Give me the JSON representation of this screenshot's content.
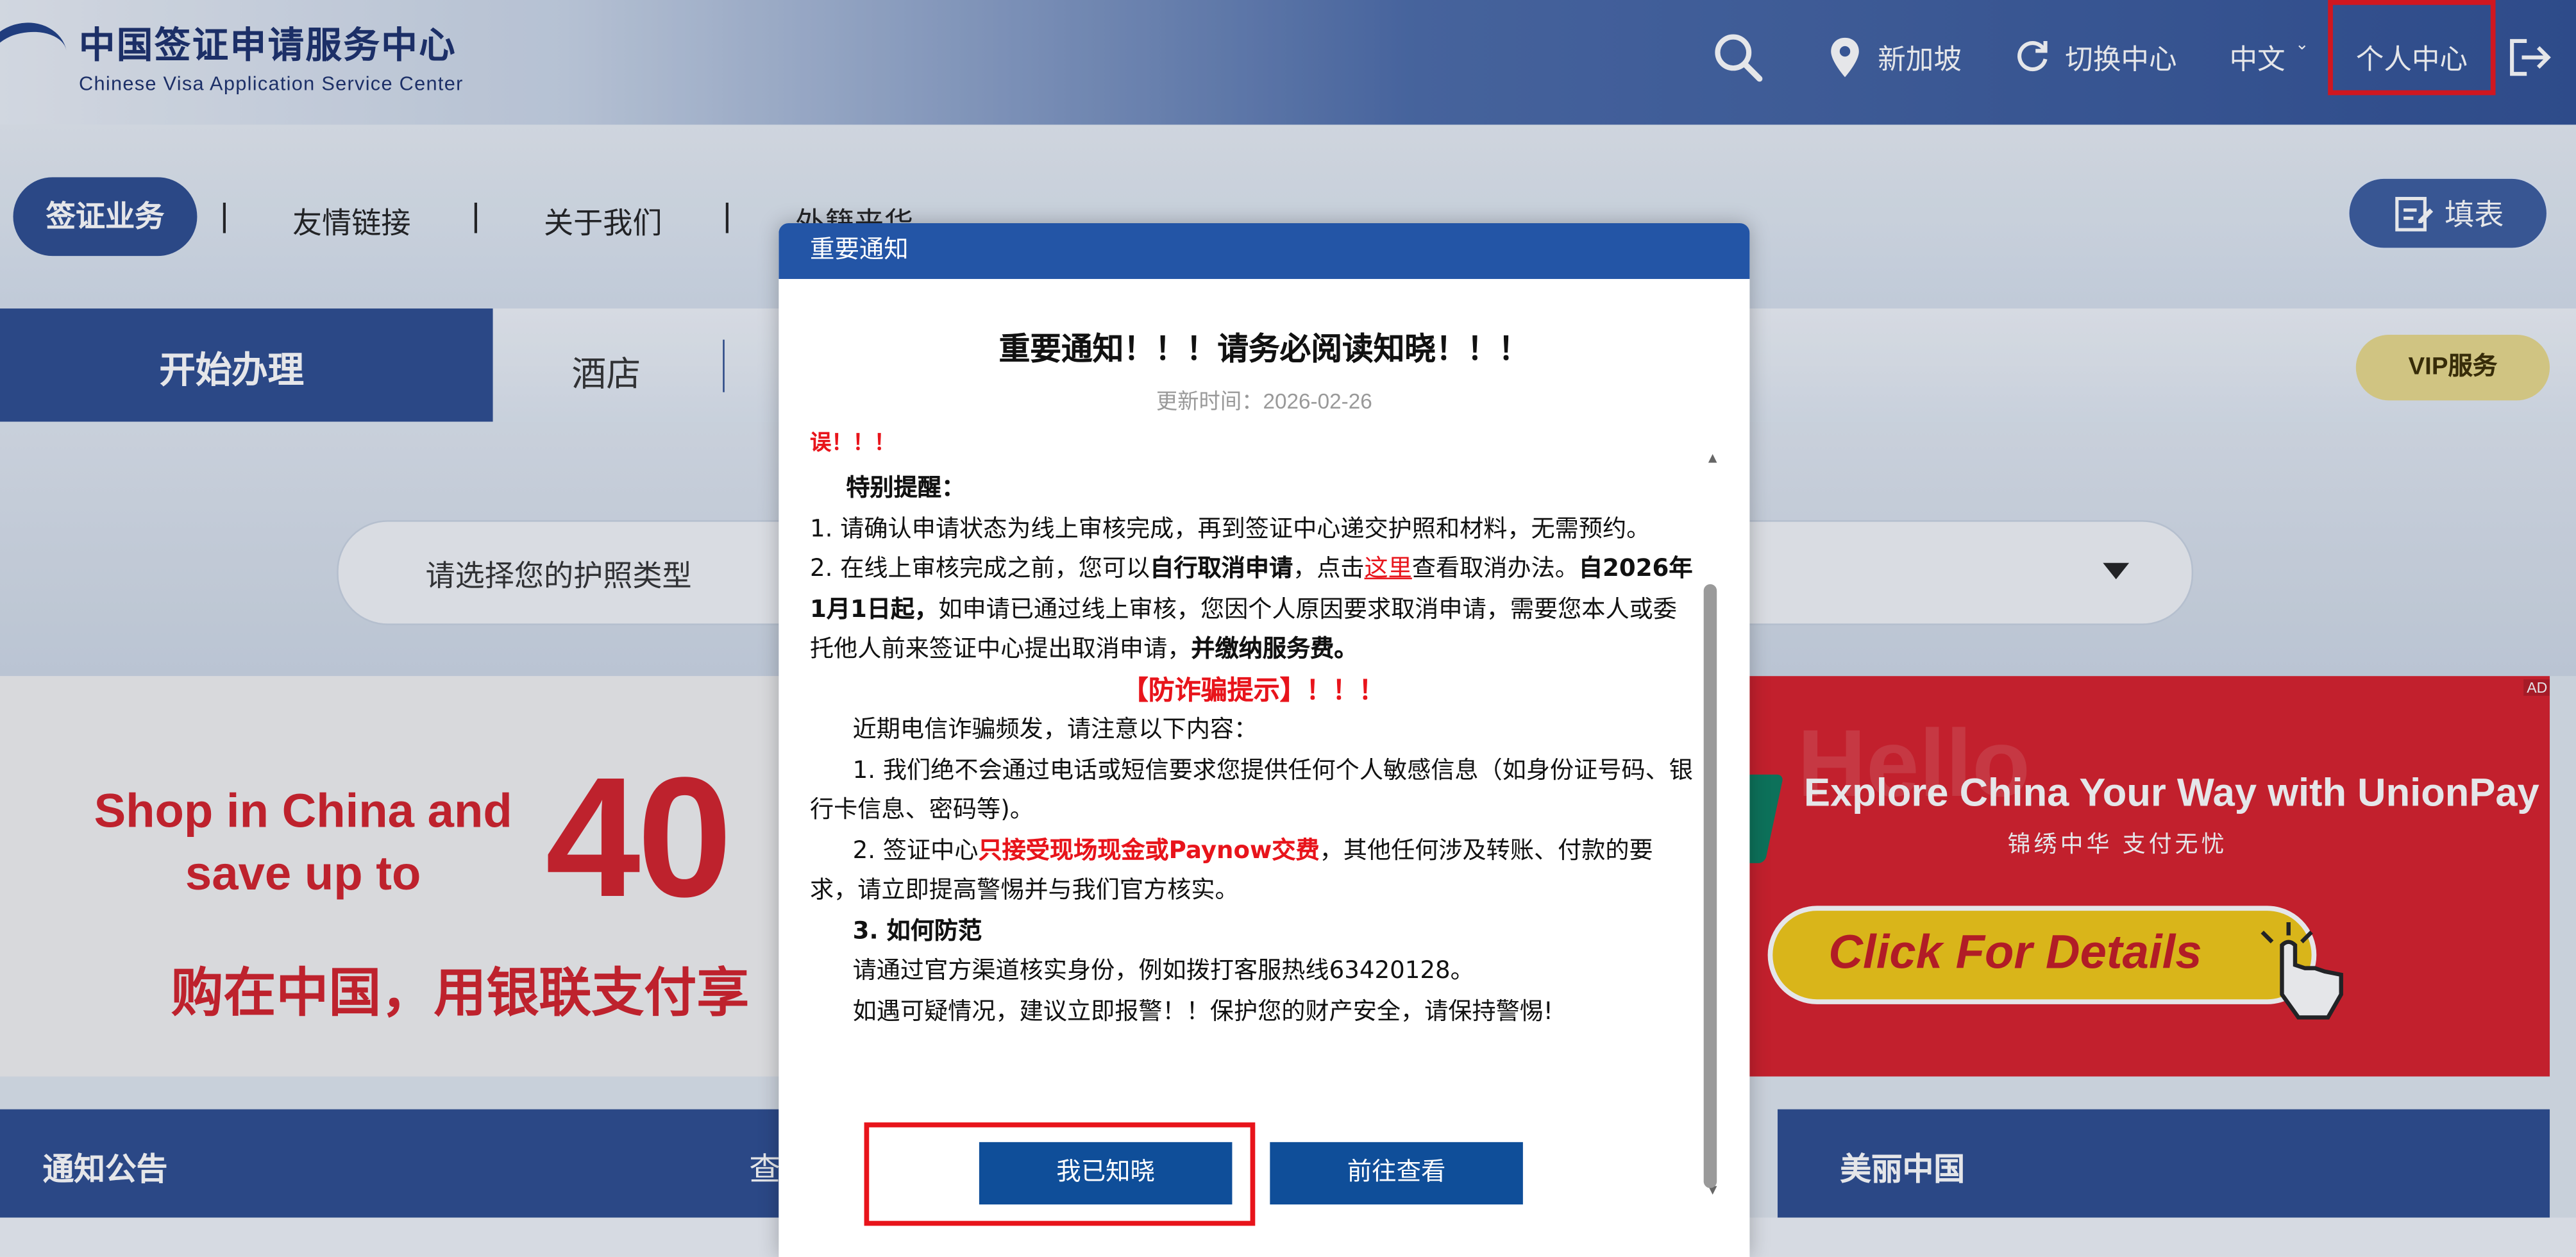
{
  "header": {
    "logo_cn": "中国签证申请服务中心",
    "logo_en": "Chinese Visa Application Service Center",
    "location": "新加坡",
    "switch_center": "切换中心",
    "language": "中文",
    "personal_center": "个人中心"
  },
  "nav": {
    "items": [
      "签证业务",
      "友情链接",
      "关于我们",
      "外籍来华"
    ],
    "separator": "|",
    "fill_form": "填表"
  },
  "tabs": {
    "start": "开始办理",
    "hotel": "酒店",
    "vip": "VIP服务"
  },
  "passport_select": {
    "placeholder": "请选择您的护照类型"
  },
  "banner": {
    "left_line1": "Shop in China and",
    "left_line2": "save up to",
    "left_big": "40",
    "left_cn": "购在中国，用银联支付享",
    "right_title": "Explore China Your Way with UnionPay",
    "right_sub": "锦绣中华  支付无忧",
    "right_button": "Click For Details",
    "ad_tag": "AD"
  },
  "bottom_bar": {
    "notice": "通知公告",
    "query": "查",
    "beautiful": "美丽中国"
  },
  "modal": {
    "title": "重要通知",
    "heading": "重要通知！！！请务必阅读知晓！！！",
    "updated": "更新时间：2026-02-26",
    "body": {
      "cut_line": "误！！！",
      "special": "特别提醒：",
      "item1": "1. 请确认申请状态为线上审核完成，再到签证中心递交护照和材料，无需预约。",
      "item2_a": "2. 在线上审核完成之前，您可以",
      "item2_b": "自行取消申请",
      "item2_c": "，点击",
      "item2_link": "这里",
      "item2_d": "查看取消办法。",
      "item2_e": "自2026年1月1日起，",
      "item2_f": "如申请已通过线上审核，您因个人原因要求取消申请，需要您本人或委托他人前来签证中心提出取消申请，",
      "item2_g": "并缴纳服务费。",
      "anti_fraud": "【防诈骗提示】！！！",
      "fraud_intro": "近期电信诈骗频发，请注意以下内容：",
      "fraud1": "1. 我们绝不会通过电话或短信要求您提供任何个人敏感信息（如身份证号码、银行卡信息、密码等)。",
      "fraud2_a": "2. 签证中心",
      "fraud2_b": "只接受现场现金或Paynow交费",
      "fraud2_c": "，其他任何涉及转账、付款的要求，请立即提高警惕并与我们官方核实。",
      "how": "3. 如何防范",
      "verify": "请通过官方渠道核实身份，例如拨打客服热线63420128。",
      "police": "如遇可疑情况，建议立即报警！！保护您的财产安全，请保持警惕!"
    },
    "btn_ack": "我已知晓",
    "btn_go": "前往查看"
  }
}
